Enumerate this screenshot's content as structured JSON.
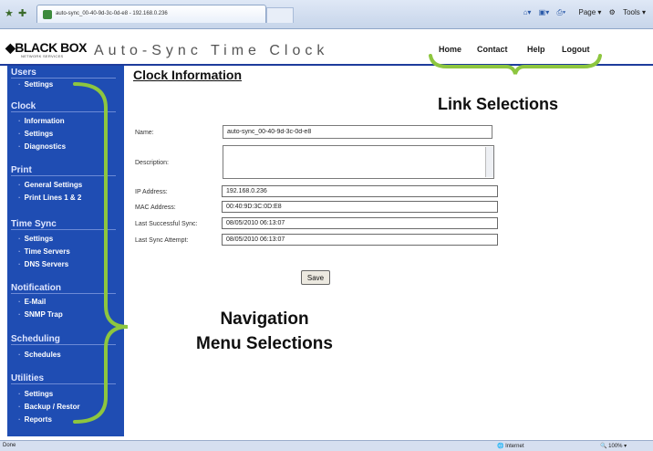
{
  "browser": {
    "tab_title": "auto-sync_00-40-9d-3c-0d-e8 - 192.168.0.236",
    "toolbar": {
      "page": "Page",
      "tools": "Tools"
    },
    "status_done": "Done",
    "status_zone": "Internet",
    "status_zoom": "100%"
  },
  "header": {
    "logo": "◆BLACK BOX",
    "logo_sub": "NETWORK SERVICES",
    "app_title": "Auto-Sync Time Clock",
    "links": [
      "Home",
      "Contact",
      "Help",
      "Logout"
    ]
  },
  "sidebar": {
    "sections": [
      {
        "title": "Users",
        "items": [
          "Settings"
        ]
      },
      {
        "title": "Clock",
        "items": [
          "Information",
          "Settings",
          "Diagnostics"
        ]
      },
      {
        "title": "Print",
        "items": [
          "General Settings",
          "Print Lines 1 & 2"
        ]
      },
      {
        "title": "Time Sync",
        "items": [
          "Settings",
          "Time Servers",
          "DNS Servers"
        ]
      },
      {
        "title": "Notification",
        "items": [
          "E-Mail",
          "SNMP Trap"
        ]
      },
      {
        "title": "Scheduling",
        "items": [
          "Schedules"
        ]
      },
      {
        "title": "Utilities",
        "items": [
          "Settings",
          "Backup / Restor",
          "Reports"
        ]
      }
    ]
  },
  "main": {
    "title": "Clock Information",
    "name_label": "Name:",
    "name_value": "auto-sync_00-40-9d-3c-0d-e8",
    "description_label": "Description:",
    "description_value": "",
    "ip_label": "IP Address:",
    "ip_value": "192.168.0.236",
    "mac_label": "MAC Address:",
    "mac_value": "00:40:9D:3C:0D:E8",
    "last_sync_label": "Last Successful Sync:",
    "last_sync_value": "08/05/2010 06:13:07",
    "last_attempt_label": "Last Sync Attempt:",
    "last_attempt_value": "08/05/2010 06:13:07",
    "save_label": "Save"
  },
  "annotations": {
    "link_selections": "Link Selections",
    "nav_line1": "Navigation",
    "nav_line2": "Menu Selections"
  },
  "colors": {
    "sidebar": "#1f4db3",
    "annotation_brace": "#8dc63f",
    "header_rule": "#1e3c9c"
  }
}
